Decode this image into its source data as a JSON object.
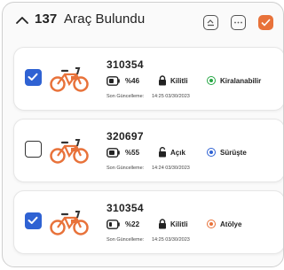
{
  "header": {
    "count": "137",
    "title": "Araç Bulundu"
  },
  "update_label": "Son Güncelleme:",
  "items": [
    {
      "id": "310354",
      "battery": "%46",
      "lock": "Kilitli",
      "status": "Kiralanabilir",
      "status_color": "#27a745",
      "updated": "14:25 03/30/2023",
      "checked": true
    },
    {
      "id": "320697",
      "battery": "%55",
      "lock": "Açık",
      "status": "Sürüşte",
      "status_color": "#2f62d3",
      "updated": "14:24 03/30/2023",
      "checked": false
    },
    {
      "id": "310354",
      "battery": "%22",
      "lock": "Kilitli",
      "status": "Atölye",
      "status_color": "#e8723a",
      "updated": "14:25 03/30/2023",
      "checked": true
    }
  ],
  "colors": {
    "accent": "#e8723a",
    "check": "#2f62d3"
  }
}
